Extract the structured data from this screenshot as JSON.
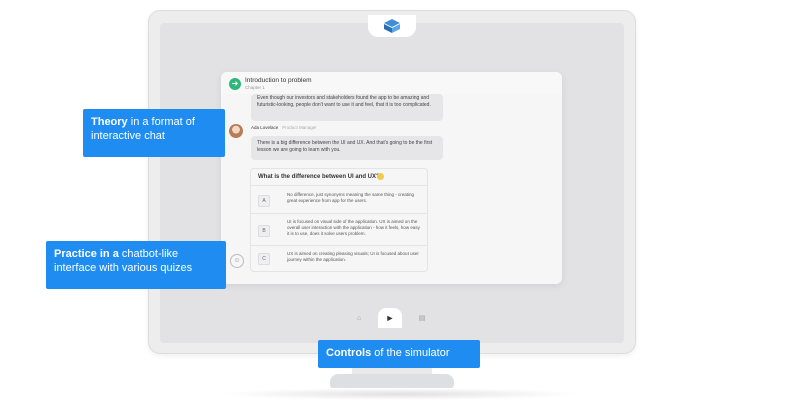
{
  "chat": {
    "title": "Introduction to problem",
    "subtitle": "Chapter 1",
    "bubble1": "Even though our investors and stakeholders found the app to be amazing and futuristic-looking, people don't want to use it and feel, that it is too complicated.",
    "author_name": "Ada Lovelace",
    "author_role": "Product Manager",
    "bubble2": "There is a big difference between the UI and UX. And that's going to be the first lesson we are going to learn with you.",
    "quiz": {
      "question": "What is the difference between UI and UX?",
      "options": [
        {
          "letter": "A",
          "text": "No difference, just synonyms meaning the same thing - creating great experience from app for the users."
        },
        {
          "letter": "B",
          "text": "UI is focused on visual side of the application. UX is aimed on the overall user interaction with the application - how it feels, how easy it is to use, does it solve users problem."
        },
        {
          "letter": "C",
          "text": "UX is aimed on creating pleasing visuals; UI is focused about user journey within the application."
        }
      ]
    }
  },
  "callouts": {
    "theory_bold": "Theory",
    "theory_rest": " in a format of interactive chat",
    "practice_bold": "Practice in a",
    "practice_rest": " chatbot-like interface with various quizes",
    "controls_bold": "Controls",
    "controls_rest": " of the simulator"
  },
  "icons": {
    "home": "home-icon",
    "play": "play-icon",
    "book": "book-icon",
    "smiley": "smiley-icon",
    "logo": "logo-icon"
  },
  "colors": {
    "accent": "#1e8cf0",
    "chapter_icon": "#2fb67a"
  }
}
